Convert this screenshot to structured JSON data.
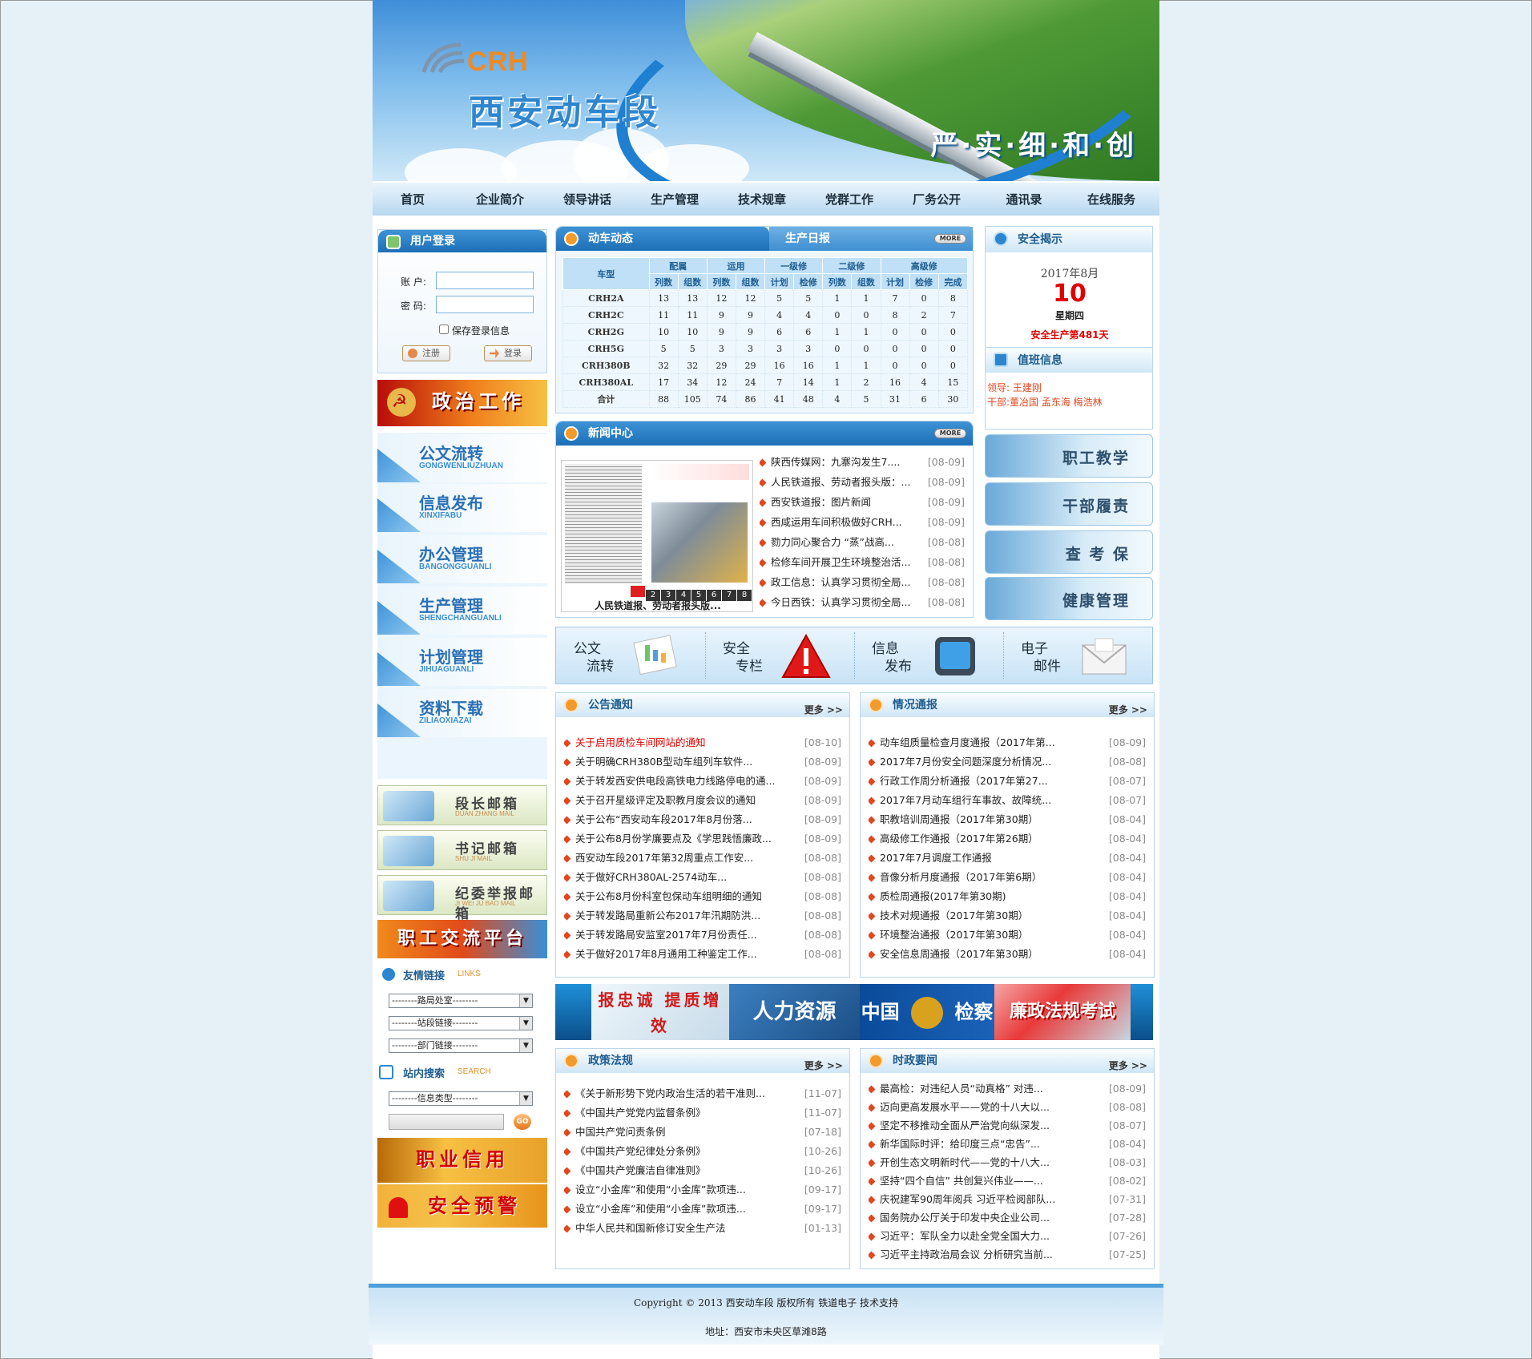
{
  "site": {
    "logo_text": "CRH",
    "title": "西安动车段",
    "slogan": "严·实·细·和·创"
  },
  "nav": [
    "首页",
    "企业简介",
    "领导讲话",
    "生产管理",
    "技术规章",
    "党群工作",
    "厂务公开",
    "通讯录",
    "在线服务"
  ],
  "login": {
    "header": "用户登录",
    "account_label": "账 户:",
    "password_label": "密 码:",
    "remember_label": "保存登录信息",
    "register_label": "注册",
    "login_label": "登录"
  },
  "left_banners": {
    "politics": "政治工作",
    "forum": "职工交流平台",
    "credit": "职业信用",
    "safety_warning": "安全预警"
  },
  "side_nav": [
    {
      "cn": "公文流转",
      "py": "GONGWENLIUZHUAN"
    },
    {
      "cn": "信息发布",
      "py": "XINXIFABU"
    },
    {
      "cn": "办公管理",
      "py": "BANGONGGUANLI"
    },
    {
      "cn": "生产管理",
      "py": "SHENGCHANGUANLI"
    },
    {
      "cn": "计划管理",
      "py": "JIHUAGUANLI"
    },
    {
      "cn": "资料下载",
      "py": "ZILIAOXIAZAI"
    }
  ],
  "mailboxes": [
    {
      "cn": "段长邮箱",
      "py": "DUAN ZHANG MAIL"
    },
    {
      "cn": "书记邮箱",
      "py": "SHU JI MAIL"
    },
    {
      "cn": "纪委举报邮箱",
      "py": "JI WEI JU BAO MAIL"
    }
  ],
  "links": {
    "header": "友情链接",
    "header_en": "LINKS",
    "options": [
      "--------路局处室--------",
      "--------站段链接--------",
      "--------部门链接--------"
    ]
  },
  "search": {
    "header": "站内搜索",
    "header_en": "SEARCH",
    "type_option": "--------信息类型--------",
    "go_label": "GO"
  },
  "dynamics": {
    "tab_active": "动车动态",
    "tab_other": "生产日报",
    "more": "MORE",
    "group_headers": [
      "车型",
      "配属",
      "运用",
      "一级修",
      "二级修",
      "高级修"
    ],
    "sub_headers": [
      "列数",
      "组数",
      "列数",
      "组数",
      "计划",
      "检修",
      "列数",
      "组数",
      "计划",
      "检修",
      "完成"
    ],
    "rows": [
      [
        "CRH2A",
        "13",
        "13",
        "12",
        "12",
        "5",
        "5",
        "1",
        "1",
        "7",
        "0",
        "8"
      ],
      [
        "CRH2C",
        "11",
        "11",
        "9",
        "9",
        "4",
        "4",
        "0",
        "0",
        "8",
        "2",
        "7"
      ],
      [
        "CRH2G",
        "10",
        "10",
        "9",
        "9",
        "6",
        "6",
        "1",
        "1",
        "0",
        "0",
        "0"
      ],
      [
        "CRH5G",
        "5",
        "5",
        "3",
        "3",
        "3",
        "3",
        "0",
        "0",
        "0",
        "0",
        "0"
      ],
      [
        "CRH380B",
        "32",
        "32",
        "29",
        "29",
        "16",
        "16",
        "1",
        "1",
        "0",
        "0",
        "0"
      ],
      [
        "CRH380AL",
        "17",
        "34",
        "12",
        "24",
        "7",
        "14",
        "1",
        "2",
        "16",
        "4",
        "15"
      ],
      [
        "合计",
        "88",
        "105",
        "74",
        "86",
        "41",
        "48",
        "4",
        "5",
        "31",
        "6",
        "30"
      ]
    ]
  },
  "news": {
    "header": "新闻中心",
    "more": "MORE",
    "photo_caption": "人民铁道报、劳动者报头版...",
    "pages": [
      "2",
      "3",
      "4",
      "5",
      "6",
      "7",
      "8"
    ],
    "items": [
      {
        "t": "陕西传媒网：九寨沟发生7....",
        "d": "[08-09]"
      },
      {
        "t": "人民铁道报、劳动者报头版：...",
        "d": "[08-09]"
      },
      {
        "t": "西安铁道报：图片新闻",
        "d": "[08-09]"
      },
      {
        "t": "西咸运用车间积极做好CRH...",
        "d": "[08-09]"
      },
      {
        "t": "勠力同心聚合力 “蒸”战高...",
        "d": "[08-08]"
      },
      {
        "t": "检修车间开展卫生环境整治活...",
        "d": "[08-08]"
      },
      {
        "t": "政工信息：认真学习贯彻全局...",
        "d": "[08-08]"
      },
      {
        "t": "今日西铁：认真学习贯彻全局...",
        "d": "[08-08]"
      }
    ]
  },
  "safety": {
    "header": "安全揭示",
    "year_month": "2017年8月",
    "day": "10",
    "weekday": "星期四",
    "days_safe": "安全生产第481天"
  },
  "duty": {
    "header": "值班信息",
    "leader_label": "领导:",
    "leader": "王建刚",
    "cadre_label": "干部:",
    "cadre": "董冶国 孟东海 梅浩林"
  },
  "right_tiles": [
    "职工教学",
    "干部履责",
    "查 考 保",
    "健康管理"
  ],
  "quick": [
    {
      "l1": "公文",
      "l2": "流转"
    },
    {
      "l1": "安全",
      "l2": "专栏"
    },
    {
      "l1": "信息",
      "l2": "发布"
    },
    {
      "l1": "电子",
      "l2": "邮件"
    }
  ],
  "notice": {
    "header": "公告通知",
    "more": "更多 >>",
    "items": [
      {
        "t": "关于启用质检车间网站的通知",
        "d": "[08-10]",
        "red": true
      },
      {
        "t": "关于明确CRH380B型动车组列车软件...",
        "d": "[08-09]"
      },
      {
        "t": "关于转发西安供电段高铁电力线路停电的通...",
        "d": "[08-09]"
      },
      {
        "t": "关于召开星级评定及职教月度会议的通知",
        "d": "[08-09]"
      },
      {
        "t": "关于公布“西安动车段2017年8月份落...",
        "d": "[08-09]"
      },
      {
        "t": "关于公布8月份学廉要点及《学思践悟廉政...",
        "d": "[08-09]"
      },
      {
        "t": "西安动车段2017年第32周重点工作安...",
        "d": "[08-08]"
      },
      {
        "t": "关于做好CRH380AL-2574动车...",
        "d": "[08-08]"
      },
      {
        "t": "关于公布8月份科室包保动车组明细的通知",
        "d": "[08-08]"
      },
      {
        "t": "关于转发路局重新公布2017年汛期防洪...",
        "d": "[08-08]"
      },
      {
        "t": "关于转发路局安监室2017年7月份责任...",
        "d": "[08-08]"
      },
      {
        "t": "关于做好2017年8月通用工种鉴定工作...",
        "d": "[08-08]"
      }
    ]
  },
  "report": {
    "header": "情况通报",
    "more": "更多 >>",
    "items": [
      {
        "t": "动车组质量检查月度通报（2017年第...",
        "d": "[08-09]"
      },
      {
        "t": "2017年7月份安全问题深度分析情况...",
        "d": "[08-08]"
      },
      {
        "t": "行政工作周分析通报（2017年第27...",
        "d": "[08-07]"
      },
      {
        "t": "2017年7月动车组行车事故、故障统...",
        "d": "[08-07]"
      },
      {
        "t": "职教培训周通报（2017年第30期）",
        "d": "[08-04]"
      },
      {
        "t": "高级修工作通报（2017年第26期）",
        "d": "[08-04]"
      },
      {
        "t": "2017年7月调度工作通报",
        "d": "[08-04]"
      },
      {
        "t": "音像分析月度通报（2017年第6期）",
        "d": "[08-04]"
      },
      {
        "t": "质检周通报(2017年第30期)",
        "d": "[08-04]"
      },
      {
        "t": "技术对规通报（2017年第30期）",
        "d": "[08-04]"
      },
      {
        "t": "环境整治通报（2017年第30期）",
        "d": "[08-04]"
      },
      {
        "t": "安全信息周通报（2017年第30期）",
        "d": "[08-04]"
      }
    ]
  },
  "ad_strip": [
    "报忠诚 提质增效",
    "人力资源",
    "中国",
    "检察",
    "廉政法规考试"
  ],
  "policy": {
    "header": "政策法规",
    "more": "更多 >>",
    "items": [
      {
        "t": "《关于新形势下党内政治生活的若干准则...",
        "d": "[11-07]"
      },
      {
        "t": "《中国共产党党内监督条例》",
        "d": "[11-07]"
      },
      {
        "t": "中国共产党问责条例",
        "d": "[07-18]"
      },
      {
        "t": "《中国共产党纪律处分条例》",
        "d": "[10-26]"
      },
      {
        "t": "《中国共产党廉洁自律准则》",
        "d": "[10-26]"
      },
      {
        "t": "设立“小金库”和使用“小金库”款项违...",
        "d": "[09-17]"
      },
      {
        "t": "设立“小金库”和使用“小金库”款项违...",
        "d": "[09-17]"
      },
      {
        "t": "中华人民共和国新修订安全生产法",
        "d": "[01-13]"
      }
    ]
  },
  "politics_news": {
    "header": "时政要闻",
    "more": "更多 >>",
    "items": [
      {
        "t": "最高检：对违纪人员“动真格” 对违...",
        "d": "[08-09]"
      },
      {
        "t": "迈向更高发展水平——党的十八大以...",
        "d": "[08-08]"
      },
      {
        "t": "坚定不移推动全面从严治党向纵深发...",
        "d": "[08-07]"
      },
      {
        "t": "新华国际时评：给印度三点“忠告”...",
        "d": "[08-04]"
      },
      {
        "t": "开创生态文明新时代——党的十八大...",
        "d": "[08-03]"
      },
      {
        "t": "坚持“四个自信” 共创复兴伟业——...",
        "d": "[08-02]"
      },
      {
        "t": "庆祝建军90周年阅兵 习近平检阅部队...",
        "d": "[07-31]"
      },
      {
        "t": "国务院办公厅关于印发中央企业公司...",
        "d": "[07-28]"
      },
      {
        "t": "习近平：军队全力以赴全党全国大力...",
        "d": "[07-26]"
      },
      {
        "t": "习近平主持政治局会议 分析研究当前...",
        "d": "[07-25]"
      }
    ]
  },
  "footer": {
    "copyright": "Copyright © 2013 西安动车段 版权所有 铁道电子 技术支持",
    "address": "地址：西安市未央区草滩8路"
  },
  "colors": {
    "primary": "#1e6fb6",
    "accent": "#e2461e",
    "date": "#8a8a8a",
    "safe_red": "#e00000"
  }
}
